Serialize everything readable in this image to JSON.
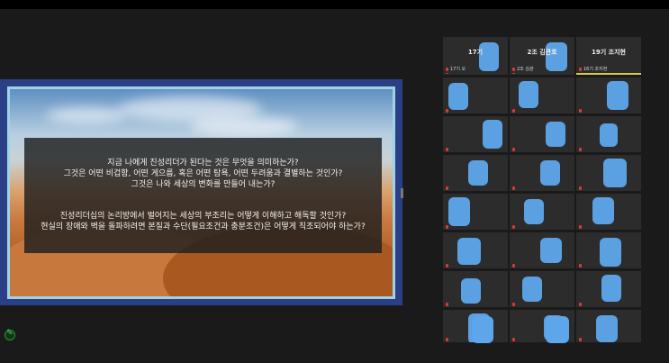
{
  "slide": {
    "lines": [
      "지금 나에게 진성리더가 된다는 것은 무엇을 의미하는가?",
      "그것은 어떤 비겁함, 어떤 게으름, 혹은 어떤 탐욕, 어떤 두려움과 결별하는 것인가?",
      "그것은 나와 세상의 변화를 만들어 내는가?",
      "진성리더십의 논리방에서 벌어지는 세상의 부조리는 어떻게 이해하고 해독할 것인가?",
      "현실의 장애와 벽을 돌파하려면 본질과 수단(필요조건과 충분조건)은 어떻게 직조되어야 하는가?"
    ]
  },
  "gallery": {
    "tiles": [
      {
        "name": "",
        "big": ""
      },
      {
        "name": "",
        "big": ""
      },
      {
        "name": "정삼",
        "big": ""
      },
      {
        "name": "",
        "big": ""
      },
      {
        "name": "",
        "big": ""
      },
      {
        "name": "",
        "big": ""
      },
      {
        "name": "",
        "big": ""
      },
      {
        "name": "",
        "big": ""
      },
      {
        "name": "",
        "big": ""
      },
      {
        "name": "",
        "big": ""
      },
      {
        "name": "",
        "big": ""
      },
      {
        "name": "",
        "big": ""
      },
      {
        "name": "",
        "big": ""
      },
      {
        "name": "",
        "big": ""
      },
      {
        "name": "",
        "big": ""
      },
      {
        "name": "",
        "big": ""
      },
      {
        "name": "",
        "big": ""
      },
      {
        "name": "",
        "big": ""
      },
      {
        "name": "",
        "big": ""
      },
      {
        "name": "",
        "big": ""
      },
      {
        "name": "",
        "big": ""
      },
      {
        "name": "",
        "big": ""
      },
      {
        "name": "",
        "big": ""
      },
      {
        "name": "",
        "big": ""
      },
      {
        "name": "17기 오",
        "big": "17기"
      },
      {
        "name": "2조 김관",
        "big": "2조 김관호"
      },
      {
        "name": "16기 조지현",
        "big": "19기 조지현"
      }
    ]
  }
}
